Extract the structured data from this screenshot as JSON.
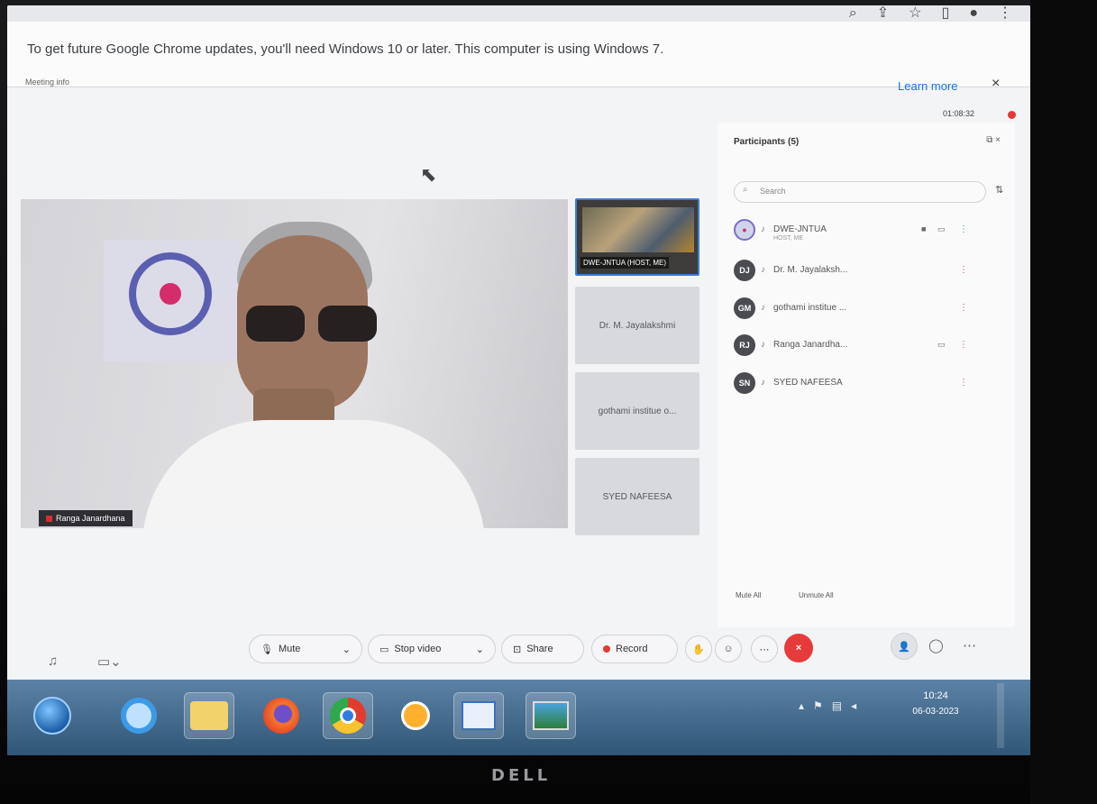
{
  "chrome": {
    "update_banner": "To get future Google Chrome updates, you'll need Windows 10 or later. This computer is using Windows 7.",
    "learn_more": "Learn more",
    "close": "×"
  },
  "meeting": {
    "info_label": "Meeting info",
    "timer": "01:08:32",
    "main_speaker": "Ranga Janardhana"
  },
  "thumbnails": [
    {
      "label": "DWE-JNTUA (HOST, ME)"
    },
    {
      "label": "Dr. M. Jayalakshmi"
    },
    {
      "label": "gothami institue o..."
    },
    {
      "label": "SYED NAFEESA"
    }
  ],
  "participants": {
    "title": "Participants (5)",
    "search_placeholder": "Search",
    "list": [
      {
        "initials": "",
        "name": "DWE-JNTUA",
        "sub": "HOST, ME"
      },
      {
        "initials": "DJ",
        "name": "Dr. M. Jayalaksh..."
      },
      {
        "initials": "GM",
        "name": "gothami institue ..."
      },
      {
        "initials": "RJ",
        "name": "Ranga Janardha..."
      },
      {
        "initials": "SN",
        "name": "SYED NAFEESA"
      }
    ],
    "mute_all": "Mute All",
    "unmute_all": "Unmute All"
  },
  "controls": {
    "mute": "Mute",
    "stop_video": "Stop video",
    "share": "Share",
    "record": "Record"
  },
  "taskbar": {
    "time": "10:24",
    "date": "06-03-2023"
  },
  "monitor_brand": "DELL"
}
